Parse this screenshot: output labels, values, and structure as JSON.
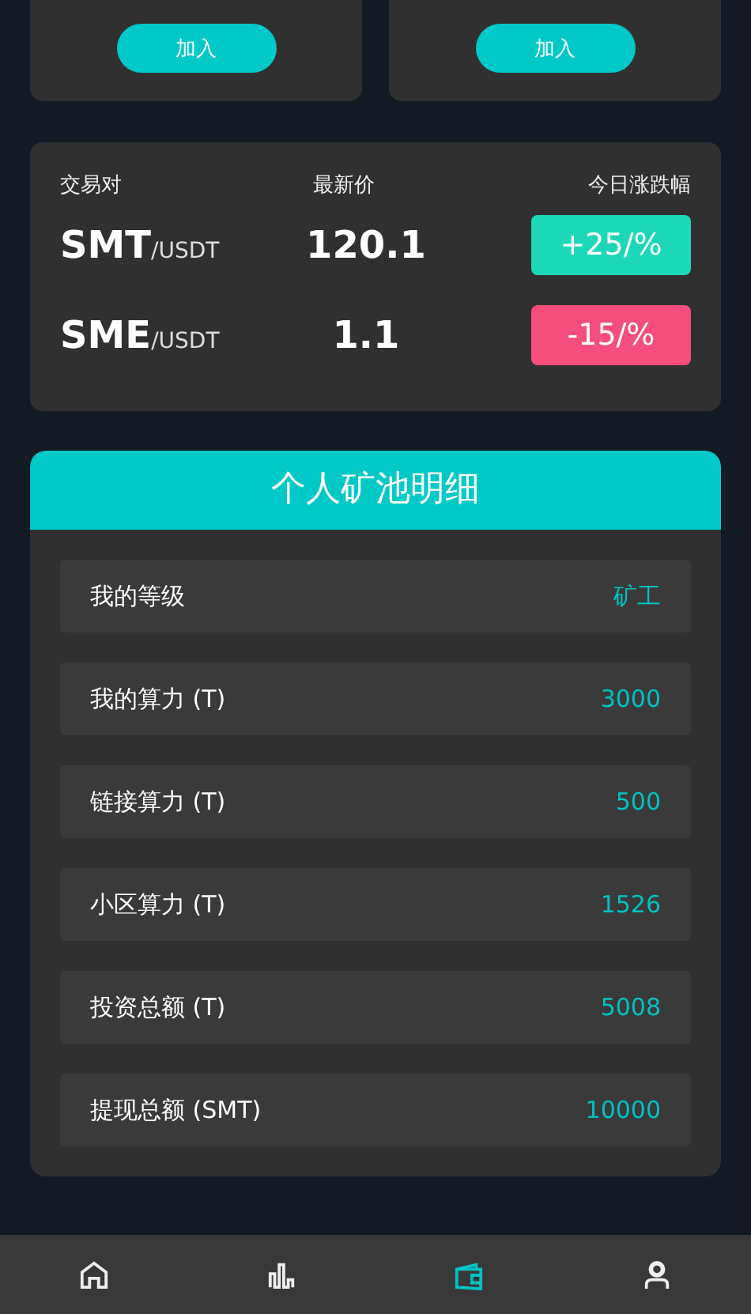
{
  "join_cards": [
    {
      "button": "加入"
    },
    {
      "button": "加入"
    }
  ],
  "market": {
    "columns": [
      "交易对",
      "最新价",
      "今日涨跌幅"
    ],
    "rows": [
      {
        "base": "SMT",
        "quote": "/USDT",
        "price": "120.1",
        "change": "+25/%",
        "color": "#1dd8b8"
      },
      {
        "base": "SME",
        "quote": "/USDT",
        "price": "1.1",
        "change": "-15/%",
        "color": "#f54d7c"
      }
    ]
  },
  "pool": {
    "title": "个人矿池明细",
    "items": [
      {
        "label": "我的等级",
        "value": "矿工"
      },
      {
        "label": "我的算力 (T)",
        "value": "3000"
      },
      {
        "label": "链接算力 (T)",
        "value": "500"
      },
      {
        "label": "小区算力 (T)",
        "value": "1526"
      },
      {
        "label": "投资总额 (T)",
        "value": "5008"
      },
      {
        "label": "提现总额 (SMT)",
        "value": "10000"
      }
    ]
  },
  "nav": [
    {
      "kind": "home",
      "selected": false
    },
    {
      "kind": "chart",
      "selected": false
    },
    {
      "kind": "wallet",
      "selected": true
    },
    {
      "kind": "user",
      "selected": false
    }
  ]
}
